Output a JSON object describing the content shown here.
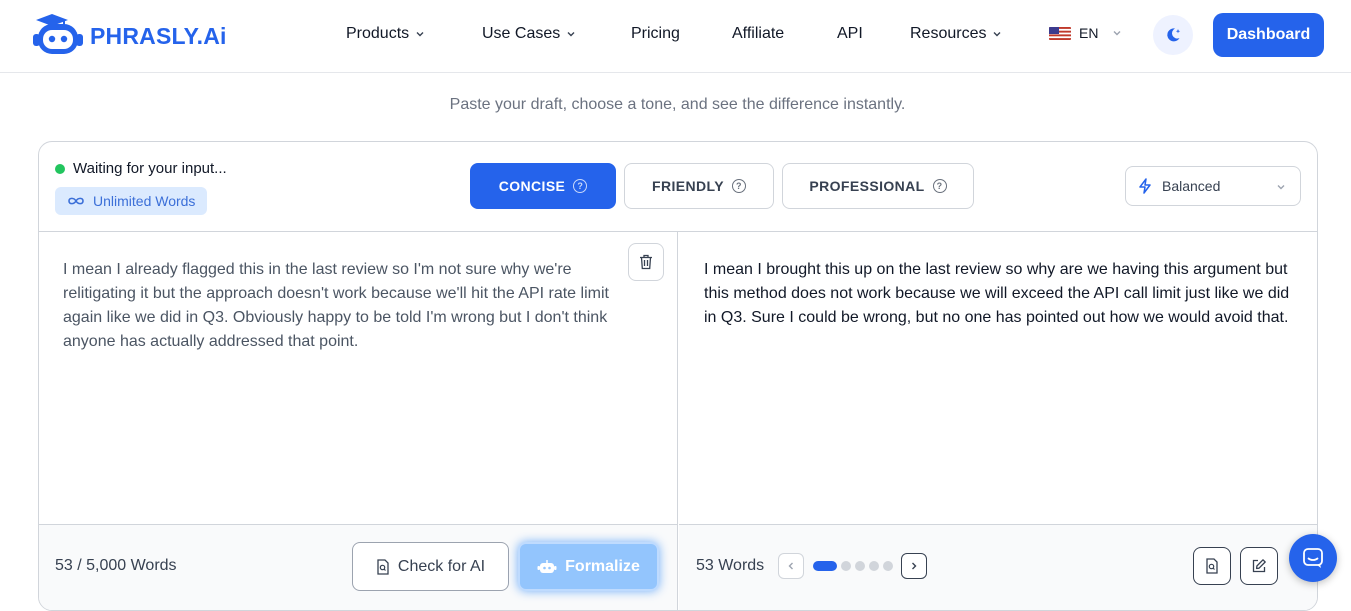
{
  "brand": {
    "name": "PHRASLY.Ai",
    "color": "#2563eb"
  },
  "nav": {
    "items": [
      {
        "label": "Products",
        "dropdown": true
      },
      {
        "label": "Use Cases",
        "dropdown": true
      },
      {
        "label": "Pricing",
        "dropdown": false
      },
      {
        "label": "Affiliate",
        "dropdown": false
      },
      {
        "label": "API",
        "dropdown": false
      },
      {
        "label": "Resources",
        "dropdown": true
      }
    ],
    "language": "EN",
    "dashboard_label": "Dashboard"
  },
  "subtitle": "Paste your draft, choose a tone, and see the difference instantly.",
  "editor": {
    "status": "Waiting for your input...",
    "badge": "Unlimited Words",
    "tones": [
      {
        "label": "CONCISE",
        "active": true
      },
      {
        "label": "FRIENDLY",
        "active": false
      },
      {
        "label": "PROFESSIONAL",
        "active": false
      }
    ],
    "mode": "Balanced",
    "input_text": "I mean I already flagged this in the last review so I'm not sure why we're relitigating it but the approach doesn't work because we'll hit the API rate limit again like we did in Q3. Obviously happy to be told I'm wrong but I don't think anyone has actually addressed that point.",
    "output_text": "I mean I brought this up on the last review so why are we having this argument but this method does not work because we will exceed the API call limit just like we did in Q3. Sure I could be wrong, but no one has pointed out how we would avoid that.",
    "input_count": "53 / 5,000 Words",
    "check_ai_label": "Check for AI",
    "formalize_label": "Formalize",
    "output_count": "53 Words",
    "pager": {
      "total": 5,
      "current": 1
    }
  },
  "icons": {
    "theme": "moon-sparkle-icon",
    "mode": "lightning-icon",
    "delete": "trash-icon",
    "check": "document-search-icon",
    "formalize": "robot-icon",
    "chat": "chat-icon"
  }
}
